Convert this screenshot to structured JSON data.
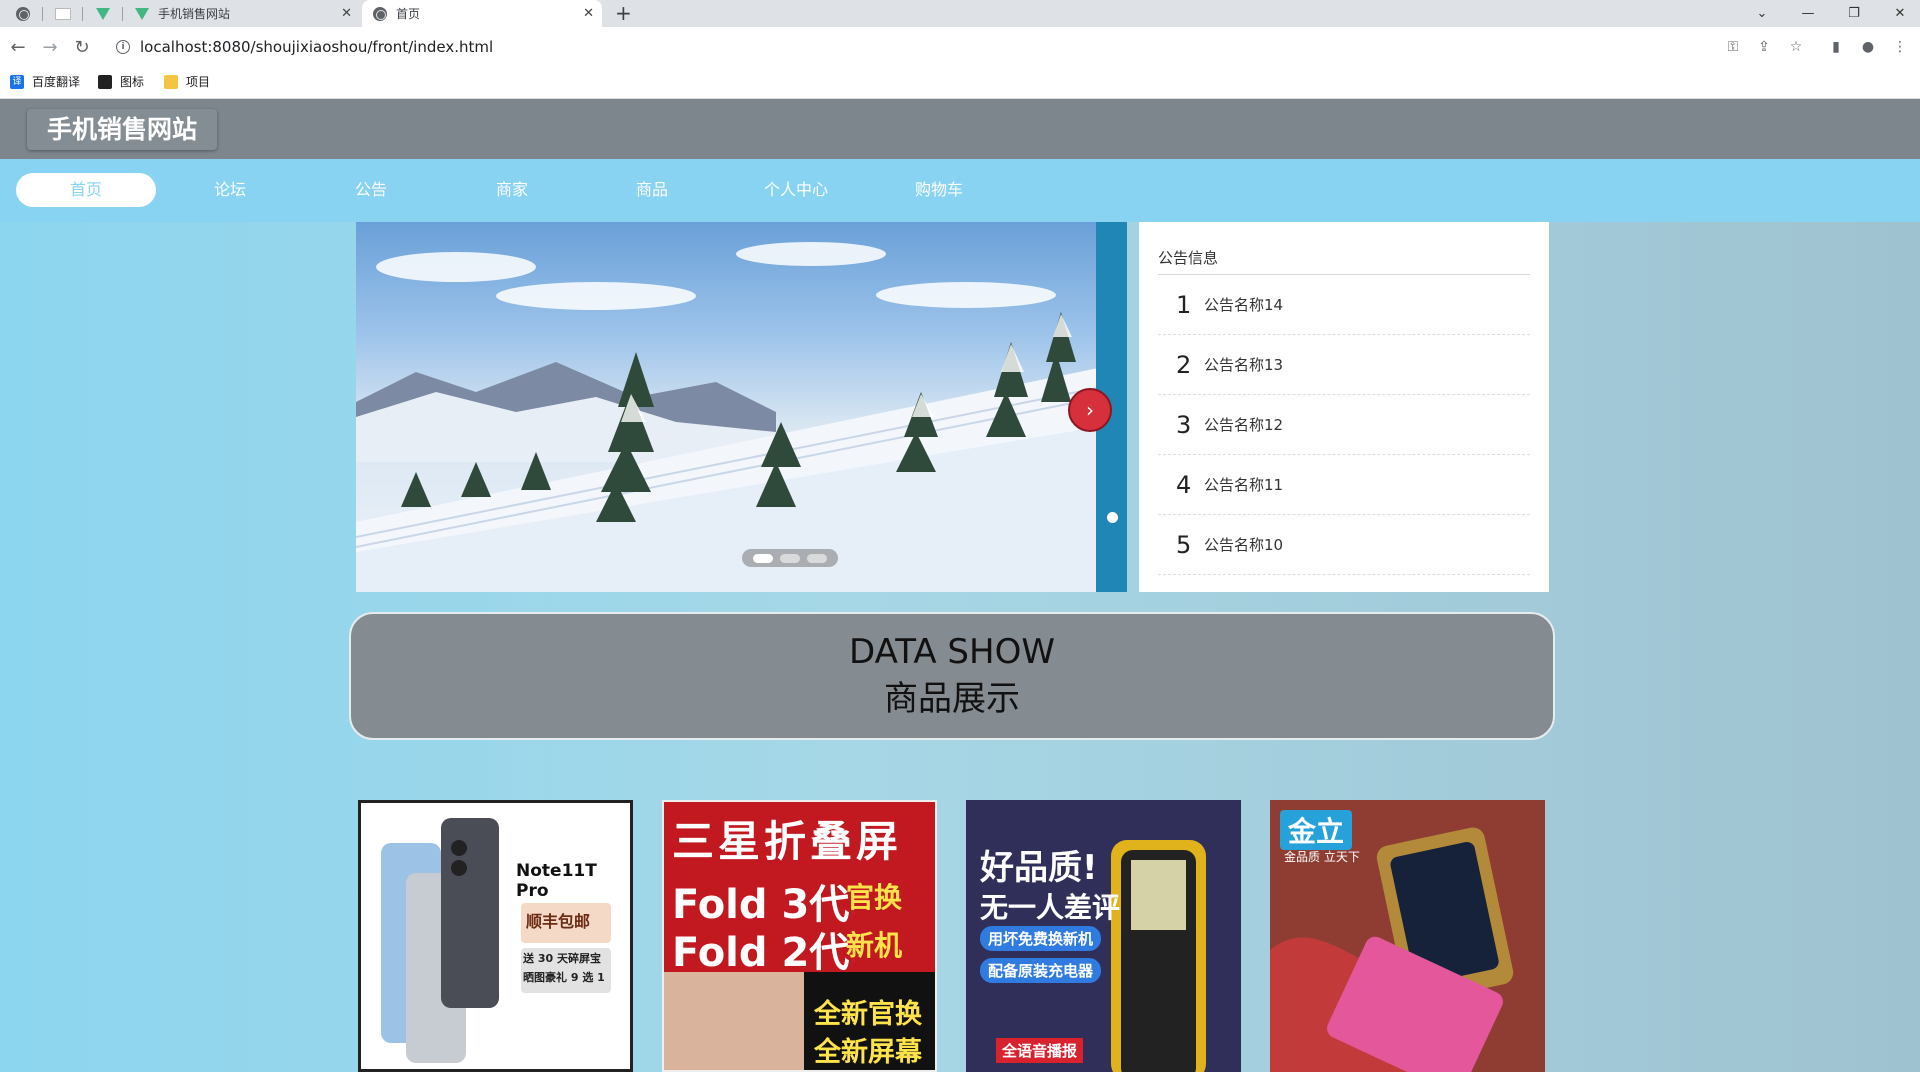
{
  "browser": {
    "tabs": [
      {
        "label": "手机销售网站",
        "active": false
      },
      {
        "label": "首页",
        "active": true
      }
    ],
    "url": "localhost:8080/shoujixiaoshou/front/index.html",
    "bookmarks": [
      "百度翻译",
      "图标",
      "项目"
    ]
  },
  "site": {
    "title": "手机销售网站"
  },
  "nav": {
    "items": [
      "首页",
      "论坛",
      "公告",
      "商家",
      "商品",
      "个人中心",
      "购物车"
    ],
    "active_index": 0
  },
  "carousel": {
    "slide_count": 3,
    "active_slide": 0
  },
  "notices": {
    "title": "公告信息",
    "items": [
      {
        "num": "1",
        "text": "公告名称14"
      },
      {
        "num": "2",
        "text": "公告名称13"
      },
      {
        "num": "3",
        "text": "公告名称12"
      },
      {
        "num": "4",
        "text": "公告名称11"
      },
      {
        "num": "5",
        "text": "公告名称10"
      }
    ]
  },
  "section": {
    "title_en": "DATA SHOW",
    "title_cn": "商品展示"
  },
  "products": [
    {
      "lines": [
        "Note11T Pro",
        "顺丰包邮",
        "送 30 天碎屏宝",
        "晒图豪礼 9 选 1"
      ]
    },
    {
      "lines": [
        "三星折叠屏",
        "Fold 3代",
        "Fold 2代",
        "官换",
        "新机",
        "全新官换",
        "全新屏幕"
      ]
    },
    {
      "lines": [
        "好品质!",
        "无一人差评",
        "用坏免费换新机",
        "配备原装充电器",
        "全语音播报"
      ]
    },
    {
      "lines": [
        "金立",
        "金品质 立天下"
      ]
    }
  ],
  "colors": {
    "header": "#7d868c",
    "nav": "#88d3f2",
    "banner_strip": "#1f86b5",
    "next_button": "#d5303c"
  }
}
